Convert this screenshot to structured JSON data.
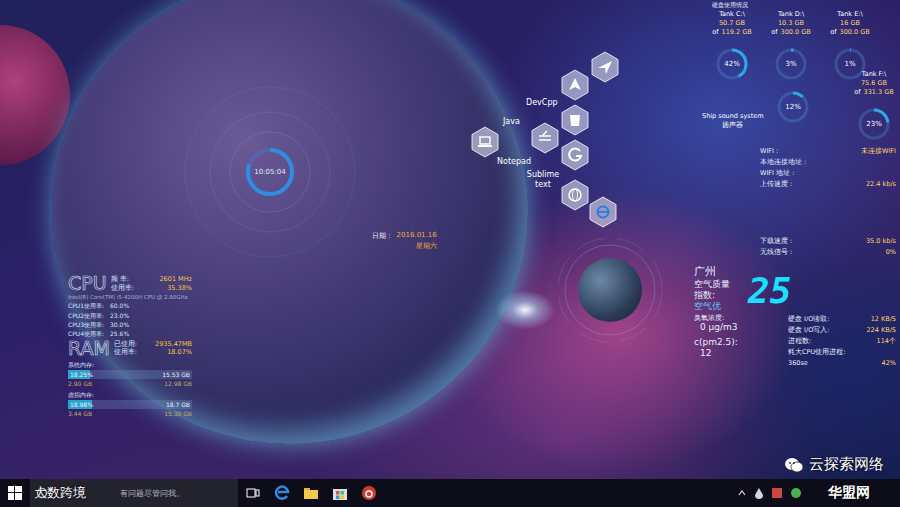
{
  "disk_panel": {
    "title": "硬盘使用情况",
    "disks": [
      {
        "name": "Tank C:\\",
        "used": "50.7 GB",
        "of": "of",
        "total": "119.2 GB",
        "percent": "42%",
        "level": 0.42
      },
      {
        "name": "Tank D:\\",
        "used": "10.3 GB",
        "of": "of",
        "total": "300.0 GB",
        "percent": "3%",
        "level": 0.03
      },
      {
        "name": "Tank E:\\",
        "used": "16 GB",
        "of": "of",
        "total": "300.0 GB",
        "percent": "1%",
        "level": 0.01
      },
      {
        "name": "Tank F:\\",
        "used": "75.6 GB",
        "of": "of",
        "total": "331.3 GB",
        "percent": "23%",
        "level": 0.23
      }
    ]
  },
  "sound": {
    "label": "Ship sound system",
    "device": "扬声器",
    "percent": "12%",
    "level": 0.12
  },
  "network": {
    "rows": [
      {
        "label": "WIFI :",
        "value": "未连接WIFI"
      },
      {
        "label": "本地连接地址 :"
      },
      {
        "label": "WIFI 地址 :"
      },
      {
        "label": "上传速度 :",
        "value": "22.4 kb/s"
      }
    ],
    "rows2": [
      {
        "label": "下载速度 :",
        "value": "35.0 kb/s"
      },
      {
        "label": "无线信号 :",
        "value": "0%"
      }
    ]
  },
  "air": {
    "city": "广州",
    "index_label": "空气质量指数:",
    "index": "25",
    "quality": "空气优",
    "ozone_label": "臭氧浓度:",
    "ozone": "0 μg/m3",
    "pm_label": "c(pm2.5):",
    "pm": "12"
  },
  "system_io": {
    "rows": [
      {
        "label": "硬盘 I/O读取:",
        "value": "12 KB/S"
      },
      {
        "label": "硬盘 I/O写入:",
        "value": "224 KB/S"
      },
      {
        "label": "进程数:",
        "value": "114个"
      },
      {
        "label": "耗大CPU使用进程:"
      }
    ],
    "top_process": {
      "name": "360se",
      "percent": "42%"
    }
  },
  "clock": {
    "time": "10:05:04",
    "level": 0.8
  },
  "date": {
    "label": "日期 :",
    "value": "2016.01.16",
    "weekday": "星期六"
  },
  "launcher": {
    "labels": [
      "DevCpp",
      "Java",
      "Notepad",
      "Sublime text"
    ]
  },
  "cpu": {
    "title": "CPU",
    "freq_label": "频 率:",
    "freq": "2601 MHz",
    "usage_label": "使用率:",
    "usage": "35.38%",
    "model": "Intel(R) Core(TM) i5-4200H CPU @ 2.80GHz",
    "cores": [
      {
        "label": "CPU1使用率:",
        "value": "60.0%"
      },
      {
        "label": "CPU2使用率:",
        "value": "23.0%"
      },
      {
        "label": "CPU3使用率:",
        "value": "30.0%"
      },
      {
        "label": "CPU4使用率:",
        "value": "25.6%"
      }
    ]
  },
  "ram": {
    "title": "RAM",
    "used_label": "已使用:",
    "used": "2935.47MB",
    "usage_label": "使用率:",
    "usage": "18.07%",
    "groups": [
      {
        "label": "系统内存:",
        "percent": "18.25%",
        "total": "15.53 GB",
        "level": 0.18,
        "left": "2.90 GB",
        "right": "12.98 GB"
      },
      {
        "label": "虚拟内存:",
        "percent": "18.98%",
        "total": "18.7 GB",
        "level": 0.19,
        "left": "3.44 GB",
        "right": "15.30 GB"
      }
    ]
  },
  "taskbar": {
    "search_placeholder": "有问题尽管问我。"
  },
  "watermarks": {
    "left": "大数跨境",
    "wechat": "云探索网络",
    "site": "华盟网"
  }
}
